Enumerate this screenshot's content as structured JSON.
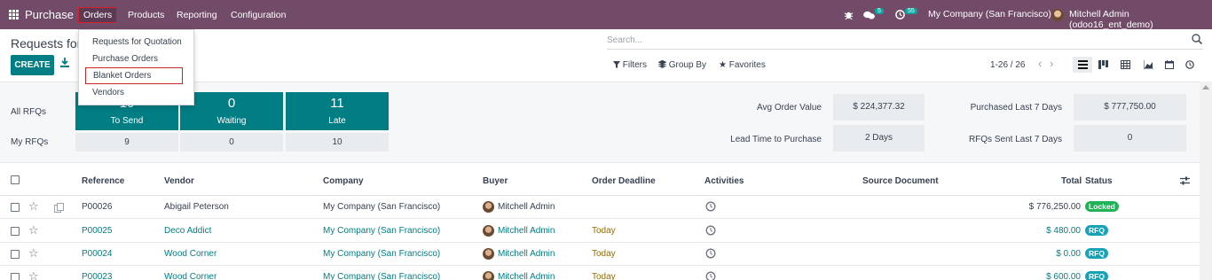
{
  "topnav": {
    "app_name": "Purchase",
    "menus": [
      "Orders",
      "Products",
      "Reporting",
      "Configuration"
    ],
    "active_menu": "Orders",
    "chat_count": "5",
    "activity_count": "55",
    "company": "My Company (San Francisco)",
    "user": "Mitchell Admin (odoo16_ent_demo)"
  },
  "orders_menu": {
    "items": [
      "Requests for Quotation",
      "Purchase Orders",
      "Blanket Orders",
      "Vendors"
    ],
    "highlighted": "Blanket Orders"
  },
  "control": {
    "title": "Requests for",
    "create_label": "CREATE",
    "search_placeholder": "Search...",
    "filters_label": "Filters",
    "groupby_label": "Group By",
    "favorites_label": "Favorites",
    "pager": "1-26 / 26"
  },
  "dashboard": {
    "all_rfqs_label": "All RFQs",
    "my_rfqs_label": "My RFQs",
    "tiles": [
      {
        "count": "10",
        "label": "To Send",
        "mine": "9"
      },
      {
        "count": "0",
        "label": "Waiting",
        "mine": "0"
      },
      {
        "count": "11",
        "label": "Late",
        "mine": "10"
      }
    ],
    "kpis": [
      {
        "label": "Avg Order Value",
        "value": "$ 224,377.32"
      },
      {
        "label": "Lead Time to Purchase",
        "value": "2 Days"
      },
      {
        "label": "Purchased Last 7 Days",
        "value": "$ 777,750.00"
      },
      {
        "label": "RFQs Sent Last 7 Days",
        "value": "0"
      }
    ]
  },
  "table": {
    "columns": [
      "Reference",
      "Vendor",
      "Company",
      "Buyer",
      "Order Deadline",
      "Activities",
      "Source Document",
      "Total",
      "Status"
    ],
    "rows": [
      {
        "reference": "P00026",
        "vendor": "Abigail Peterson",
        "company": "My Company (San Francisco)",
        "buyer": "Mitchell Admin",
        "deadline": "",
        "total": "$ 776,250.00",
        "status": "Locked"
      },
      {
        "reference": "P00025",
        "vendor": "Deco Addict",
        "company": "My Company (San Francisco)",
        "buyer": "Mitchell Admin",
        "deadline": "Today",
        "total": "$ 480.00",
        "status": "RFQ"
      },
      {
        "reference": "P00024",
        "vendor": "Wood Corner",
        "company": "My Company (San Francisco)",
        "buyer": "Mitchell Admin",
        "deadline": "Today",
        "total": "$ 0.00",
        "status": "RFQ"
      },
      {
        "reference": "P00023",
        "vendor": "Wood Corner",
        "company": "My Company (San Francisco)",
        "buyer": "Mitchell Admin",
        "deadline": "Today",
        "total": "$ 600.00",
        "status": "RFQ"
      }
    ]
  },
  "colors": {
    "nav_bg": "#714B67",
    "primary": "#017e84",
    "locked_badge": "#21b356",
    "rfq_badge": "#17a2b8",
    "highlight_border": "#c9252c"
  }
}
